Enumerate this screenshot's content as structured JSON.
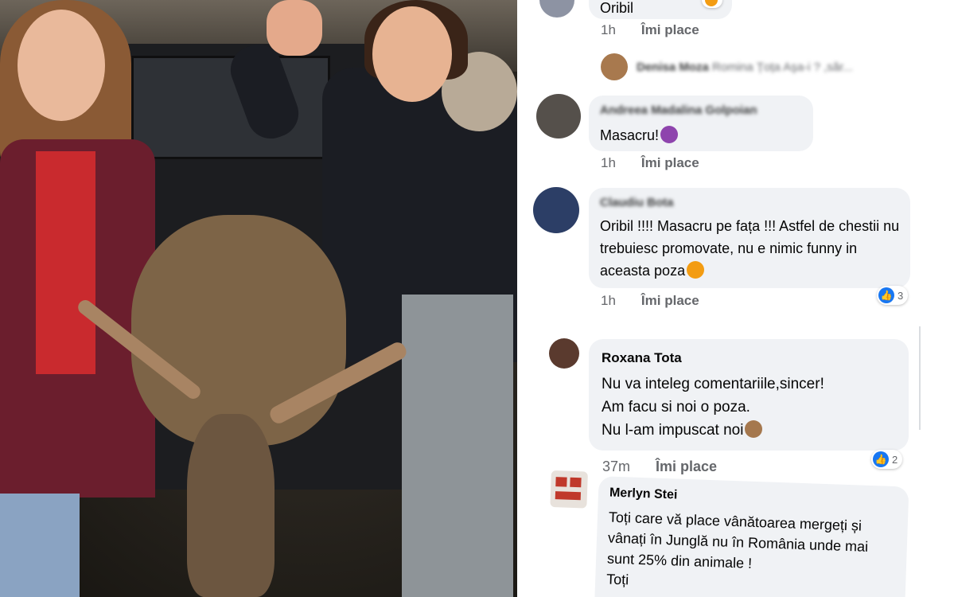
{
  "comments": [
    {
      "text": "Oribil",
      "time": "1h",
      "like": "Îmi place"
    },
    {
      "reply_author": "Denisa Moza",
      "reply_snippet": "Romina Țoța  Aşa-i ? ,săr..."
    },
    {
      "author": "Andreea Madalina Golpoian",
      "text": "Masacru!",
      "time": "1h",
      "like": "Îmi place"
    },
    {
      "author": "Claudiu Bota",
      "text": "Oribil !!!! Masacru pe fața !!! Astfel de chestii nu trebuiesc promovate, nu e nimic funny in aceasta poza",
      "time": "1h",
      "like": "Îmi place",
      "reactions": "3"
    },
    {
      "author": "Roxana Tota",
      "lines": [
        "Nu va inteleg comentariile,sincer!",
        "Am facu si noi o poza.",
        "Nu l-am impuscat noi"
      ],
      "time": "37m",
      "like": "Îmi place",
      "reactions": "2"
    },
    {
      "author": "Merlyn Stei",
      "text": "Toți care vă place vânătoarea mergeți și vânați în Junglă nu în România unde mai sunt 25% din animale !",
      "trail": "Toți"
    }
  ],
  "icons": {
    "like": "thumbs-up-icon",
    "devil": "devil-face-emoji",
    "angry": "angry-face-emoji",
    "monkey": "see-no-evil-monkey-emoji"
  },
  "colors": {
    "bubble": "#f0f2f5",
    "meta": "#65676b",
    "like_blue": "#1877f2"
  }
}
